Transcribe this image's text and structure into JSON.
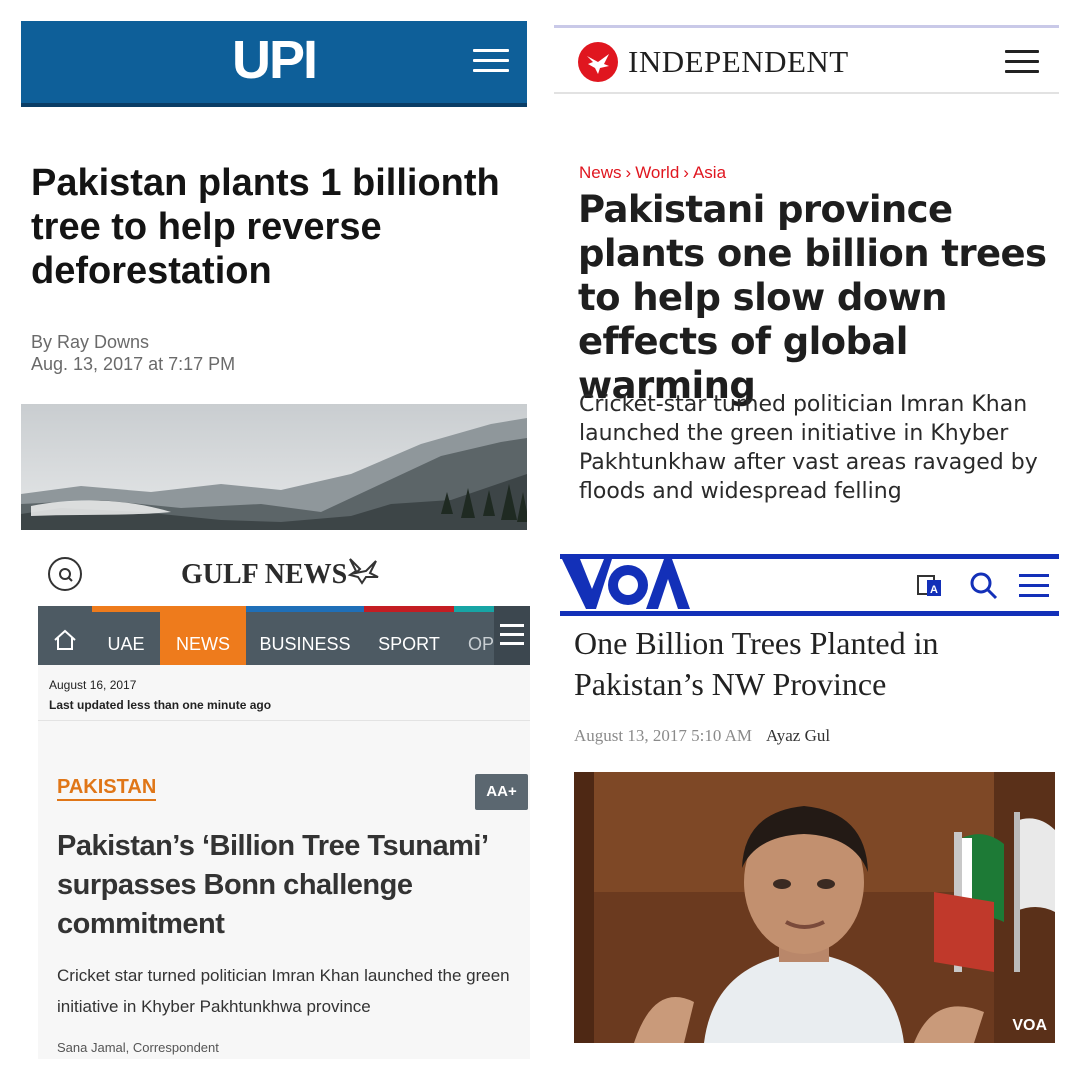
{
  "upi": {
    "logo": "UPI",
    "headline": "Pakistan plants 1 billionth tree to help reverse deforestation",
    "byline": "By Ray Downs",
    "date": "Aug. 13, 2017 at 7:17 PM"
  },
  "independent": {
    "logo": "INDEPENDENT",
    "breadcrumb": [
      "News",
      "World",
      "Asia"
    ],
    "breadcrumb_sep": "›",
    "headline": "Pakistani province plants one billion trees to help slow down effects of global warming",
    "standfirst": "Cricket-star turned politician Imran Khan launched the green initiative in Khyber Pakhtunkhaw after vast areas ravaged by floods and widespread felling"
  },
  "gulf_news": {
    "logo": "GULF NEWS",
    "nav": [
      "UAE",
      "NEWS",
      "BUSINESS",
      "SPORT",
      "OP"
    ],
    "active_nav": "NEWS",
    "date": "August 16, 2017",
    "updated": "Last updated less than one minute ago",
    "section": "PAKISTAN",
    "text_size_button": "AA+",
    "headline": "Pakistan’s ‘Billion Tree Tsunami’ surpasses Bonn challenge commitment",
    "standfirst": "Cricket star turned politician Imran Khan launched the green initiative in Khyber Pakhtunkhwa province",
    "author": "Sana Jamal, Correspondent"
  },
  "voa": {
    "headline": "One Billion Trees Planted in Pakistan’s NW Province",
    "date": "August 13, 2017 5:10 AM",
    "author": "Ayaz Gul",
    "photo_watermark": "VOA"
  },
  "colors": {
    "upi_blue": "#0e5f99",
    "independent_red": "#e0161f",
    "gulf_orange": "#ee7b1c",
    "voa_blue": "#1330b8"
  }
}
